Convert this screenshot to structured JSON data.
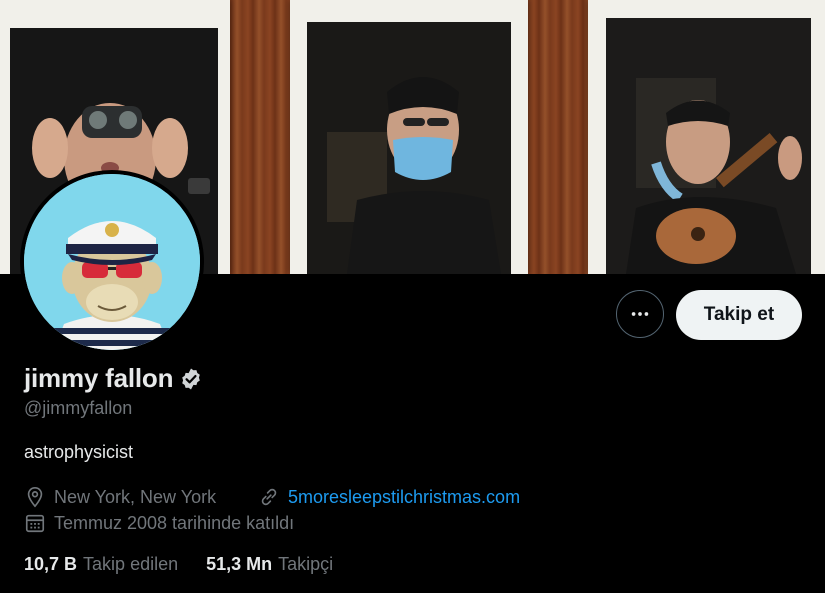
{
  "profile": {
    "display_name": "jimmy fallon",
    "handle": "@jimmyfallon",
    "bio": "astrophysicist",
    "location": "New York, New York",
    "website": "5moresleepstilchristmas.com",
    "joined": "Temmuz 2008 tarihinde katıldı",
    "verified": true
  },
  "actions": {
    "follow_label": "Takip et",
    "more_icon": "ellipsis-icon"
  },
  "stats": [
    {
      "value": "10,7 B",
      "label": "Takip edilen"
    },
    {
      "value": "51,3 Mn",
      "label": "Takipçi"
    }
  ],
  "icons": {
    "location": "map-pin-icon",
    "link": "link-icon",
    "calendar": "calendar-icon",
    "verified": "verified-badge-icon"
  },
  "colors": {
    "background": "#000000",
    "text_primary": "#e7e9ea",
    "text_secondary": "#71767b",
    "link": "#1d9bf0",
    "follow_button_bg": "#eff3f4"
  }
}
